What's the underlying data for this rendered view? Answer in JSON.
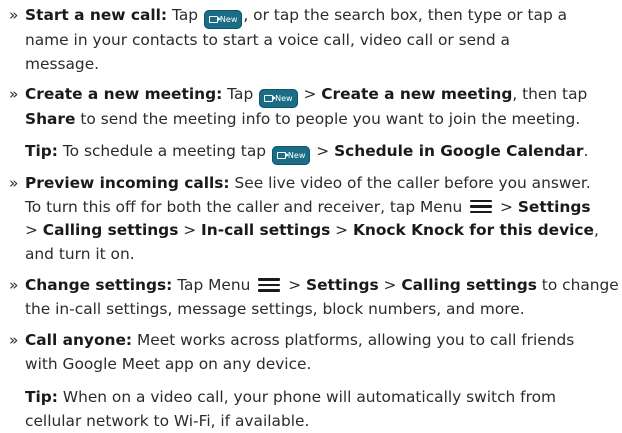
{
  "bullet": "»",
  "new_button_label": "New",
  "items": [
    {
      "lines": [
        {
          "b": "Start a new call:",
          "t1": " Tap ",
          "btn": true,
          "t2": ", or tap the search box, then type or tap a"
        },
        {
          "t1": "name in your contacts to start a voice call, video call or send a"
        },
        {
          "t1": "message."
        }
      ]
    },
    {
      "lines": [
        {
          "b": "Create a new meeting:",
          "t1": " Tap ",
          "btn": true,
          "t2": " > ",
          "b2": "Create a new meeting",
          "t3": ", then tap"
        },
        {
          "b": "Share",
          "t1": " to send the meeting info to people you want to join the meeting."
        }
      ]
    },
    {
      "tip": true,
      "lines": [
        {
          "b": "Tip:",
          "t1": " To schedule a meeting tap ",
          "btn": true,
          "t2": " > ",
          "b2": "Schedule in Google Calendar",
          "t3": "."
        }
      ]
    },
    {
      "lines": [
        {
          "b": "Preview incoming calls:",
          "t1": " See live video of the caller before you answer."
        },
        {
          "t1": "To turn this off for both the caller and receiver, tap Menu ",
          "menu": true,
          "t2": " > ",
          "b2": "Settings"
        },
        {
          "t1": "> ",
          "b": "Calling settings",
          "t2": " > ",
          "b2": "In-call settings",
          "t3": " > ",
          "b3": "Knock Knock for this device",
          "t4": ","
        },
        {
          "t1": "and turn it on."
        }
      ]
    },
    {
      "lines": [
        {
          "b": "Change settings:",
          "t1": " Tap Menu ",
          "menu": true,
          "t2": " > ",
          "b2": "Settings",
          "t3": " > ",
          "b3": "Calling settings",
          "t4": " to change"
        },
        {
          "t1": "the in-call settings, message settings, block numbers, and more."
        }
      ]
    },
    {
      "lines": [
        {
          "b": "Call anyone:",
          "t1": " Meet works across platforms, allowing you to call friends"
        },
        {
          "t1": "with Google Meet app on any device."
        }
      ]
    },
    {
      "tip": true,
      "lines": [
        {
          "b": "Tip:",
          "t1": " When on a video call, your phone will automatically switch from"
        },
        {
          "t1": "cellular network to Wi-Fi, if available."
        }
      ]
    }
  ]
}
